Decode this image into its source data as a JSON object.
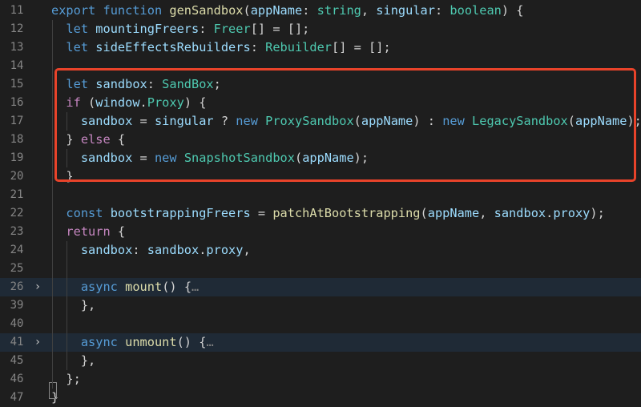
{
  "colors": {
    "background": "#1e1e1e",
    "keyword": "#569cd6",
    "control": "#c586c0",
    "function": "#dcdcaa",
    "type": "#4ec9b0",
    "identifier": "#9cdcfe",
    "plain": "#d4d4d4",
    "line_number": "#858585",
    "highlight_box": "#e8432a"
  },
  "lines": [
    {
      "num": "11",
      "fold": false,
      "highlight": false,
      "tokens": [
        [
          "kw",
          "export"
        ],
        [
          "pl",
          " "
        ],
        [
          "kw",
          "function"
        ],
        [
          "pl",
          " "
        ],
        [
          "fn",
          "genSandbox"
        ],
        [
          "pl",
          "("
        ],
        [
          "id",
          "appName"
        ],
        [
          "pl",
          ": "
        ],
        [
          "ty",
          "string"
        ],
        [
          "pl",
          ", "
        ],
        [
          "id",
          "singular"
        ],
        [
          "pl",
          ": "
        ],
        [
          "ty",
          "boolean"
        ],
        [
          "pl",
          ") {"
        ]
      ]
    },
    {
      "num": "12",
      "fold": false,
      "highlight": false,
      "tokens": [
        [
          "pl",
          "  "
        ],
        [
          "kw",
          "let"
        ],
        [
          "pl",
          " "
        ],
        [
          "id",
          "mountingFreers"
        ],
        [
          "pl",
          ": "
        ],
        [
          "ty",
          "Freer"
        ],
        [
          "pl",
          "[] = [];"
        ]
      ]
    },
    {
      "num": "13",
      "fold": false,
      "highlight": false,
      "tokens": [
        [
          "pl",
          "  "
        ],
        [
          "kw",
          "let"
        ],
        [
          "pl",
          " "
        ],
        [
          "id",
          "sideEffectsRebuilders"
        ],
        [
          "pl",
          ": "
        ],
        [
          "ty",
          "Rebuilder"
        ],
        [
          "pl",
          "[] = [];"
        ]
      ]
    },
    {
      "num": "14",
      "fold": false,
      "highlight": false,
      "tokens": []
    },
    {
      "num": "15",
      "fold": false,
      "highlight": false,
      "tokens": [
        [
          "pl",
          "  "
        ],
        [
          "kw",
          "let"
        ],
        [
          "pl",
          " "
        ],
        [
          "id",
          "sandbox"
        ],
        [
          "pl",
          ": "
        ],
        [
          "ty",
          "SandBox"
        ],
        [
          "pl",
          ";"
        ]
      ]
    },
    {
      "num": "16",
      "fold": false,
      "highlight": false,
      "tokens": [
        [
          "pl",
          "  "
        ],
        [
          "kw2",
          "if"
        ],
        [
          "pl",
          " ("
        ],
        [
          "id",
          "window"
        ],
        [
          "pl",
          "."
        ],
        [
          "ty",
          "Proxy"
        ],
        [
          "pl",
          ") {"
        ]
      ]
    },
    {
      "num": "17",
      "fold": false,
      "highlight": false,
      "tokens": [
        [
          "pl",
          "    "
        ],
        [
          "id",
          "sandbox"
        ],
        [
          "pl",
          " = "
        ],
        [
          "id",
          "singular"
        ],
        [
          "pl",
          " ? "
        ],
        [
          "kw",
          "new"
        ],
        [
          "pl",
          " "
        ],
        [
          "ty",
          "ProxySandbox"
        ],
        [
          "pl",
          "("
        ],
        [
          "id",
          "appName"
        ],
        [
          "pl",
          ") : "
        ],
        [
          "kw",
          "new"
        ],
        [
          "pl",
          " "
        ],
        [
          "ty",
          "LegacySandbox"
        ],
        [
          "pl",
          "("
        ],
        [
          "id",
          "appName"
        ],
        [
          "pl",
          ");"
        ]
      ]
    },
    {
      "num": "18",
      "fold": false,
      "highlight": false,
      "tokens": [
        [
          "pl",
          "  } "
        ],
        [
          "kw2",
          "else"
        ],
        [
          "pl",
          " {"
        ]
      ]
    },
    {
      "num": "19",
      "fold": false,
      "highlight": false,
      "tokens": [
        [
          "pl",
          "    "
        ],
        [
          "id",
          "sandbox"
        ],
        [
          "pl",
          " = "
        ],
        [
          "kw",
          "new"
        ],
        [
          "pl",
          " "
        ],
        [
          "ty",
          "SnapshotSandbox"
        ],
        [
          "pl",
          "("
        ],
        [
          "id",
          "appName"
        ],
        [
          "pl",
          ");"
        ]
      ]
    },
    {
      "num": "20",
      "fold": false,
      "highlight": false,
      "tokens": [
        [
          "pl",
          "  }"
        ]
      ]
    },
    {
      "num": "21",
      "fold": false,
      "highlight": false,
      "tokens": []
    },
    {
      "num": "22",
      "fold": false,
      "highlight": false,
      "tokens": [
        [
          "pl",
          "  "
        ],
        [
          "kw",
          "const"
        ],
        [
          "pl",
          " "
        ],
        [
          "id",
          "bootstrappingFreers"
        ],
        [
          "pl",
          " = "
        ],
        [
          "fn",
          "patchAtBootstrapping"
        ],
        [
          "pl",
          "("
        ],
        [
          "id",
          "appName"
        ],
        [
          "pl",
          ", "
        ],
        [
          "id",
          "sandbox"
        ],
        [
          "pl",
          "."
        ],
        [
          "id",
          "proxy"
        ],
        [
          "pl",
          ");"
        ]
      ]
    },
    {
      "num": "23",
      "fold": false,
      "highlight": false,
      "tokens": [
        [
          "pl",
          "  "
        ],
        [
          "kw2",
          "return"
        ],
        [
          "pl",
          " {"
        ]
      ]
    },
    {
      "num": "24",
      "fold": false,
      "highlight": false,
      "tokens": [
        [
          "pl",
          "    "
        ],
        [
          "id",
          "sandbox"
        ],
        [
          "pl",
          ": "
        ],
        [
          "id",
          "sandbox"
        ],
        [
          "pl",
          "."
        ],
        [
          "id",
          "proxy"
        ],
        [
          "pl",
          ","
        ]
      ]
    },
    {
      "num": "25",
      "fold": false,
      "highlight": false,
      "tokens": []
    },
    {
      "num": "26",
      "fold": true,
      "highlight": true,
      "tokens": [
        [
          "pl",
          "    "
        ],
        [
          "kw",
          "async"
        ],
        [
          "pl",
          " "
        ],
        [
          "fn",
          "mount"
        ],
        [
          "pl",
          "() {"
        ],
        [
          "cm",
          "…"
        ]
      ]
    },
    {
      "num": "39",
      "fold": false,
      "highlight": false,
      "tokens": [
        [
          "pl",
          "    },"
        ]
      ]
    },
    {
      "num": "40",
      "fold": false,
      "highlight": false,
      "tokens": []
    },
    {
      "num": "41",
      "fold": true,
      "highlight": true,
      "tokens": [
        [
          "pl",
          "    "
        ],
        [
          "kw",
          "async"
        ],
        [
          "pl",
          " "
        ],
        [
          "fn",
          "unmount"
        ],
        [
          "pl",
          "() {"
        ],
        [
          "cm",
          "…"
        ]
      ]
    },
    {
      "num": "45",
      "fold": false,
      "highlight": false,
      "tokens": [
        [
          "pl",
          "    },"
        ]
      ]
    },
    {
      "num": "46",
      "fold": false,
      "highlight": false,
      "tokens": [
        [
          "pl",
          "  };"
        ]
      ]
    },
    {
      "num": "47",
      "fold": false,
      "highlight": false,
      "tokens": [
        [
          "pl",
          "}"
        ]
      ]
    }
  ]
}
